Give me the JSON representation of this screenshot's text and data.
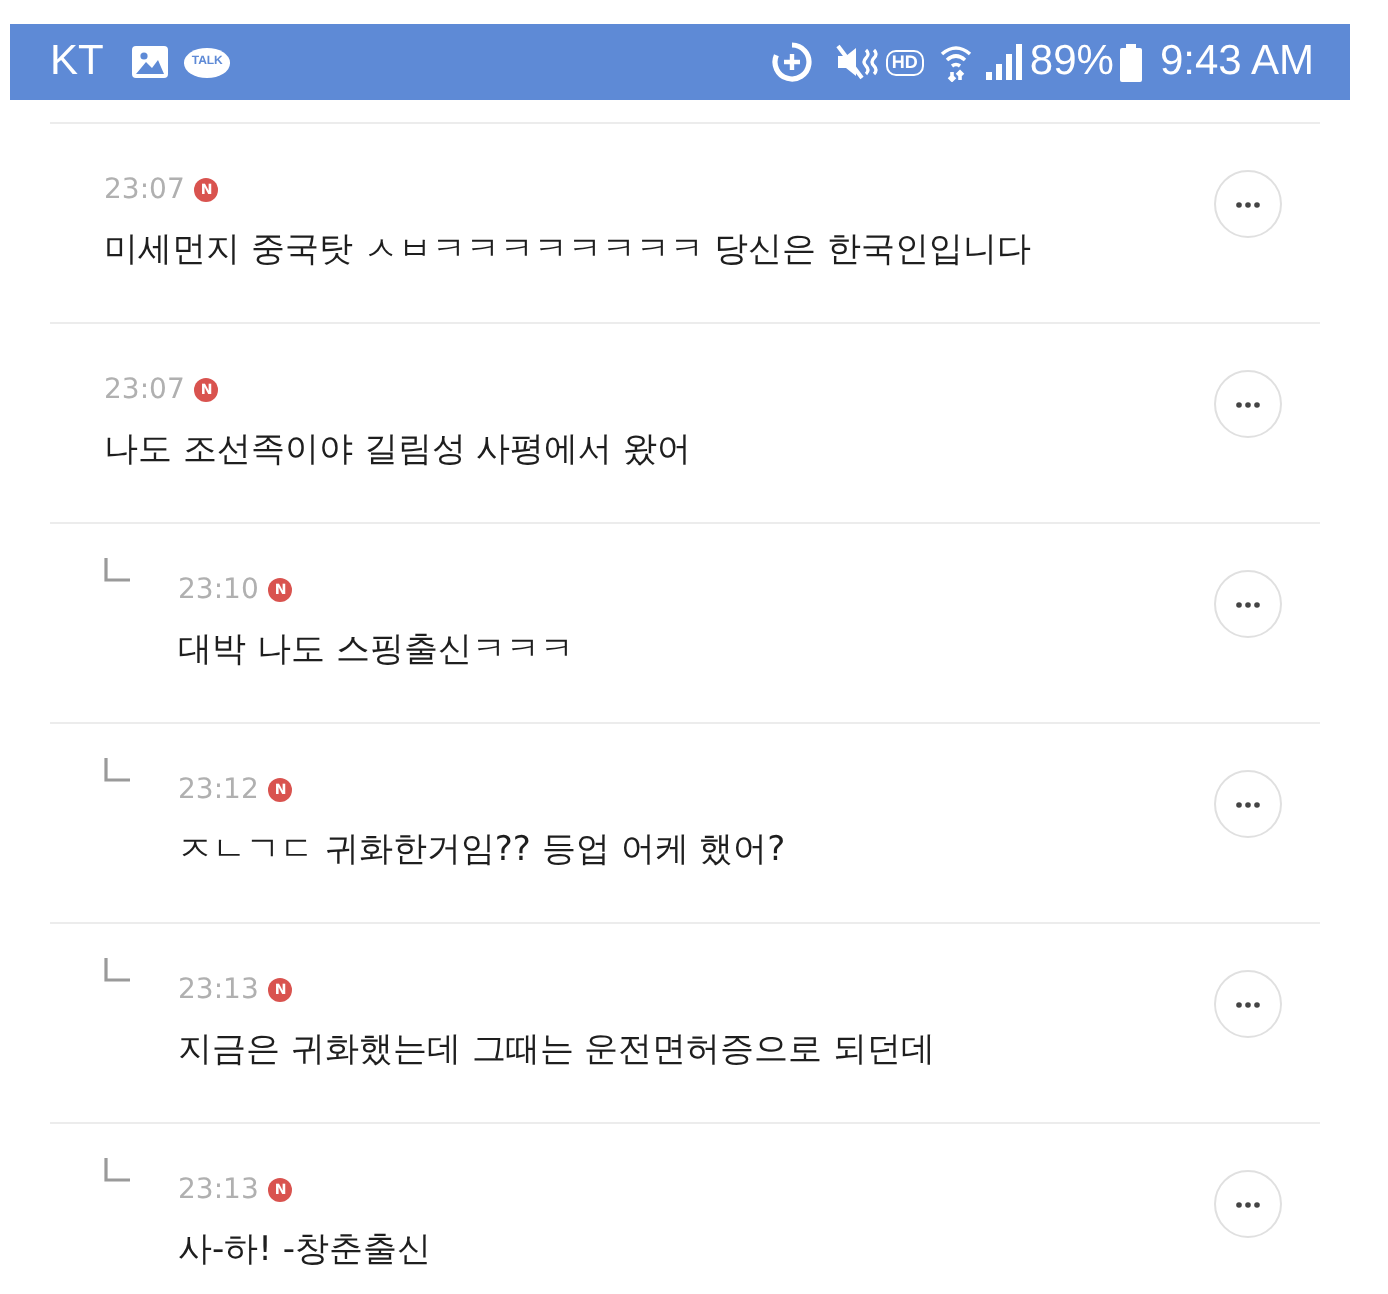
{
  "status_bar": {
    "carrier": "KT",
    "talk_badge": "TALK",
    "hd_badge": "HD",
    "battery": "89%",
    "time": "9:43 AM"
  },
  "comments": [
    {
      "kind": "comment",
      "time": "23:07",
      "badge": "N",
      "text": "미세먼지 중국탓 ㅅㅂㅋㅋㅋㅋㅋㅋㅋㅋ 당신은 한국인입니다"
    },
    {
      "kind": "comment",
      "time": "23:07",
      "badge": "N",
      "text": "나도 조선족이야 길림성 사평에서 왔어"
    },
    {
      "kind": "reply",
      "time": "23:10",
      "badge": "N",
      "text": "대박 나도 스핑출신ㅋㅋㅋ"
    },
    {
      "kind": "reply",
      "time": "23:12",
      "badge": "N",
      "text": "ㅈㄴㄱㄷ 귀화한거임?? 등업 어케 했어?"
    },
    {
      "kind": "reply",
      "time": "23:13",
      "badge": "N",
      "text": "지금은 귀화했는데 그때는 운전면허증으로 되던데"
    },
    {
      "kind": "reply",
      "time": "23:13",
      "badge": "N",
      "text": "사-하! -창춘출신"
    }
  ]
}
